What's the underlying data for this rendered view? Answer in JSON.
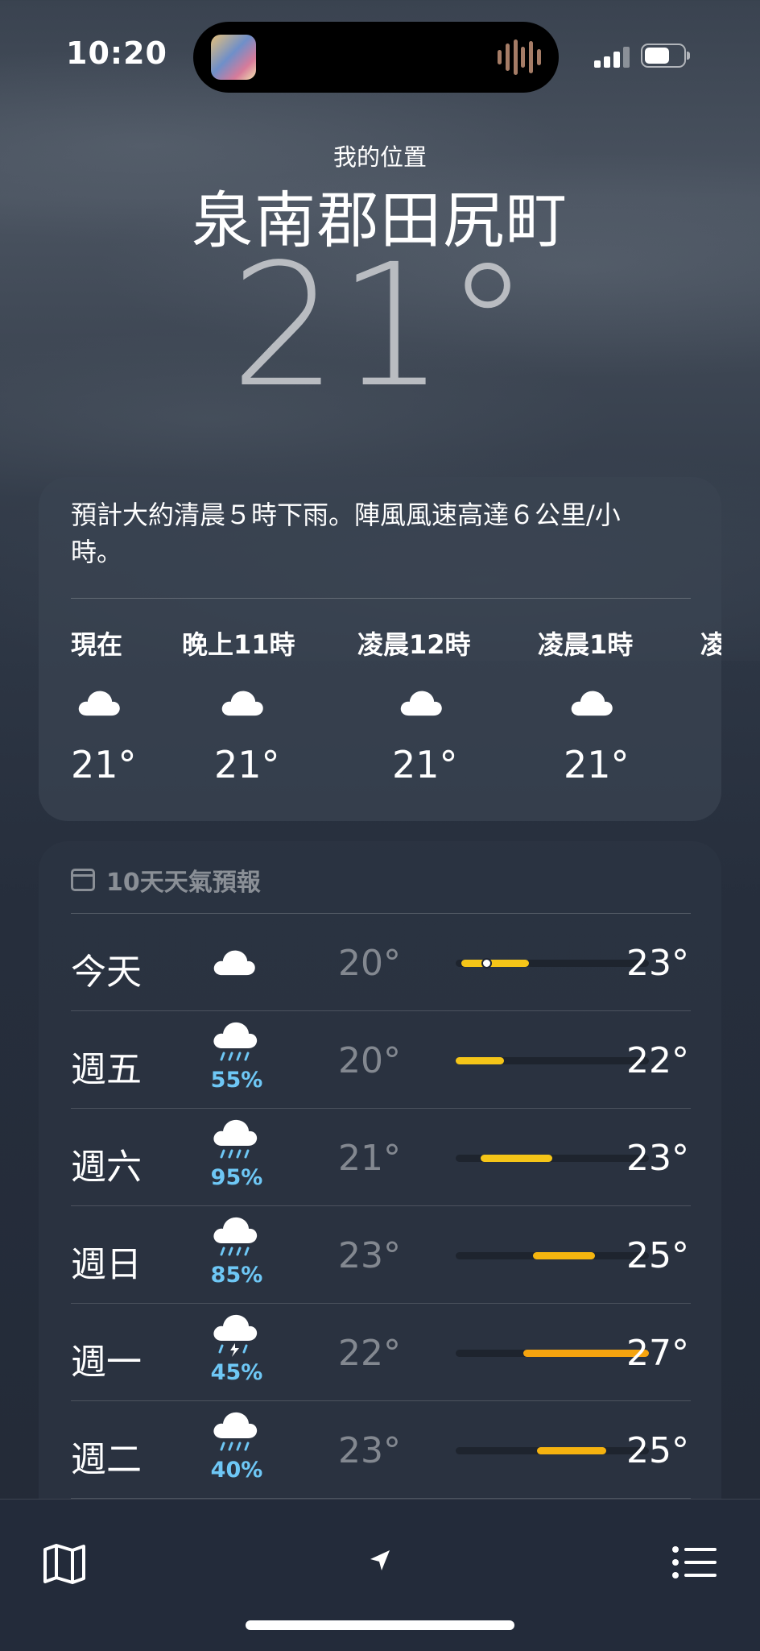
{
  "status_bar": {
    "time": "10:20"
  },
  "header": {
    "location_label": "我的位置",
    "city": "泉南郡田尻町",
    "current_temp": "21°"
  },
  "hourly": {
    "summary": "預計大約清晨５時下雨。陣風風速高達６公里/小時。",
    "items": [
      {
        "label": "現在",
        "icon": "cloud-icon",
        "temp": "21°"
      },
      {
        "label": "晚上11時",
        "icon": "cloud-icon",
        "temp": "21°"
      },
      {
        "label": "凌晨12時",
        "icon": "cloud-icon",
        "temp": "21°"
      },
      {
        "label": "凌晨1時",
        "icon": "cloud-icon",
        "temp": "21°"
      },
      {
        "label": "凌",
        "icon": "",
        "temp": ""
      }
    ]
  },
  "forecast": {
    "title": "10天天氣預報",
    "days": [
      {
        "day": "今天",
        "icon": "cloud-icon",
        "precip": "",
        "low": "20°",
        "high": "23°",
        "range": [
          0.03,
          0.38
        ],
        "current": 0.16,
        "color": "#f5c518"
      },
      {
        "day": "週五",
        "icon": "cloud-rain-icon",
        "precip": "55%",
        "low": "20°",
        "high": "22°",
        "range": [
          0.0,
          0.25
        ],
        "color": "#f5c518"
      },
      {
        "day": "週六",
        "icon": "cloud-rain-icon",
        "precip": "95%",
        "low": "21°",
        "high": "23°",
        "range": [
          0.13,
          0.5
        ],
        "color": "#f5c518"
      },
      {
        "day": "週日",
        "icon": "cloud-rain-icon",
        "precip": "85%",
        "low": "23°",
        "high": "25°",
        "range": [
          0.4,
          0.72
        ],
        "color": "#f5b50f"
      },
      {
        "day": "週一",
        "icon": "cloud-bolt-rain-icon",
        "precip": "45%",
        "low": "22°",
        "high": "27°",
        "range": [
          0.35,
          1.0
        ],
        "color": "#f5a40f"
      },
      {
        "day": "週二",
        "icon": "cloud-rain-icon",
        "precip": "40%",
        "low": "23°",
        "high": "25°",
        "range": [
          0.42,
          0.78
        ],
        "color": "#f5b20f"
      }
    ]
  },
  "tabbar": {
    "left": "map-icon",
    "center": "location-arrow-icon",
    "right": "list-icon"
  }
}
